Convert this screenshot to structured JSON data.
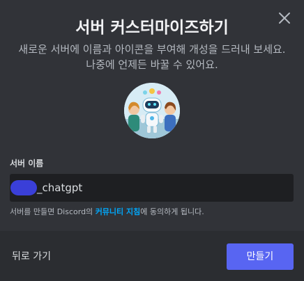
{
  "modal": {
    "title": "서버 커스터마이즈하기",
    "subtitle": "새로운 서버에 이름과 아이콘을 부여해 개성을 드러내 보세요. 나중에 언제든 바꿀 수 있어요.",
    "close_icon": "close-icon"
  },
  "form": {
    "server_name_label": "서버 이름",
    "server_name_value": "_chatgpt",
    "terms_prefix": "서버를 만들면 Discord의 ",
    "terms_link": "커뮤니티 지침",
    "terms_suffix": "에 동의하게 됩니다."
  },
  "footer": {
    "back_label": "뒤로 가기",
    "create_label": "만들기"
  },
  "colors": {
    "accent": "#5865f2",
    "link": "#00a8fc",
    "modal_bg": "#313338",
    "footer_bg": "#2b2d31",
    "input_bg": "#1e1f22"
  }
}
